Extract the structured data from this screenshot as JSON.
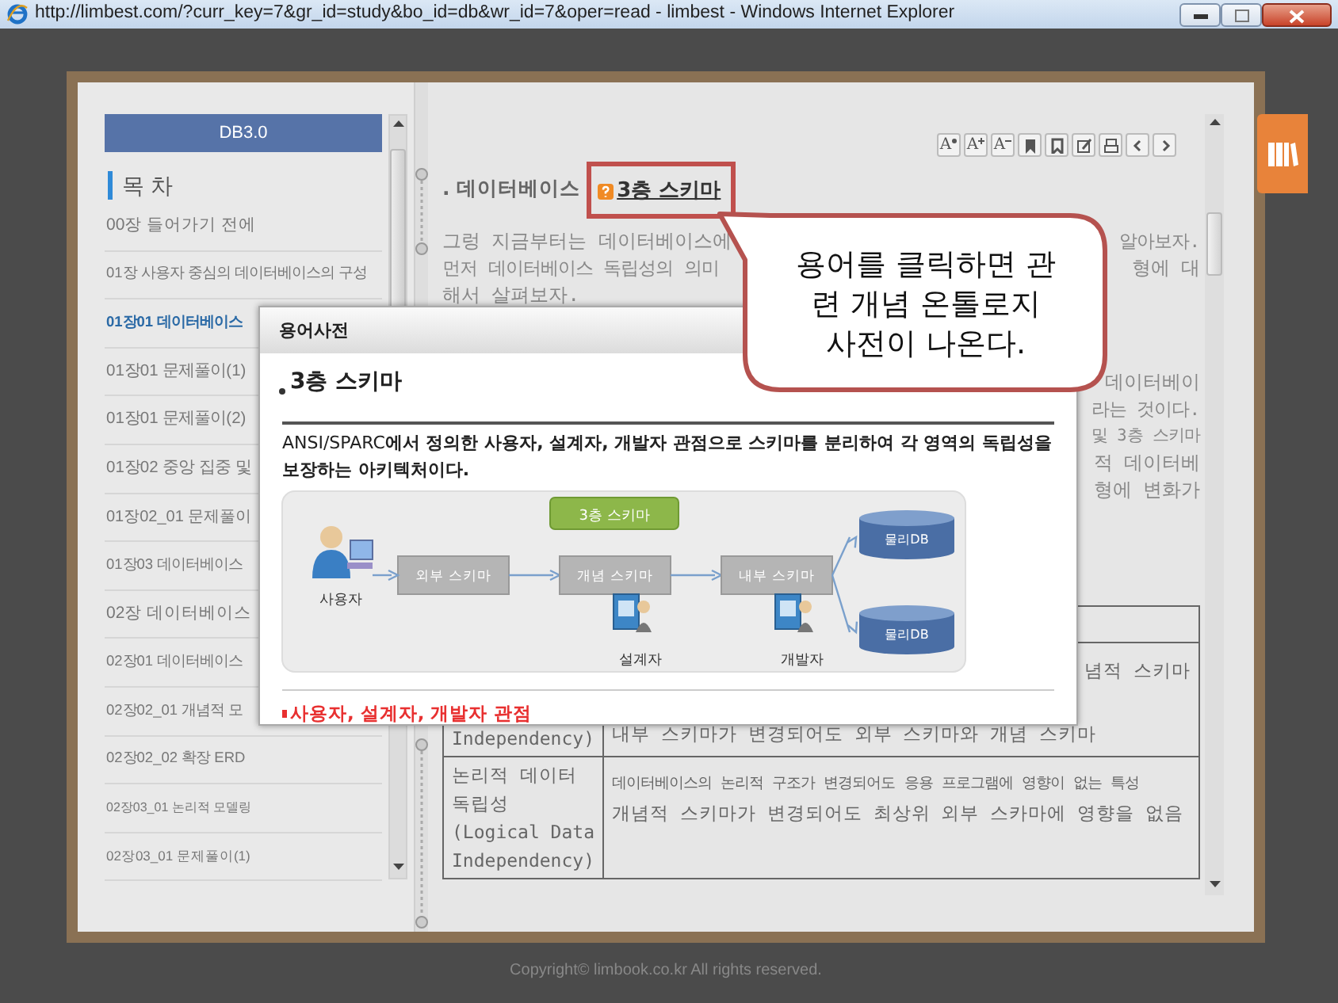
{
  "window": {
    "title": "http://limbest.com/?curr_key=7&gr_id=study&bo_id=db&wr_id=7&oper=read - limbest - Windows Internet Explorer"
  },
  "sidebar": {
    "header": "DB3.0",
    "toc_title": "목 차",
    "items": [
      {
        "label": "00장 들어가기 전에",
        "selected": false
      },
      {
        "label": "01장 사용자 중심의 데이터베이스의 구성",
        "selected": false
      },
      {
        "label": "01장01 데이터베이스",
        "selected": true
      },
      {
        "label": "01장01 문제풀이(1)",
        "selected": false
      },
      {
        "label": "01장01 문제풀이(2)",
        "selected": false
      },
      {
        "label": "01장02 중앙 집중 및",
        "selected": false
      },
      {
        "label": "01장02_01 문제풀이",
        "selected": false
      },
      {
        "label": "01장03 데이터베이스",
        "selected": false
      },
      {
        "label": "02장 데이터베이스",
        "selected": false
      },
      {
        "label": "02장01 데이터베이스",
        "selected": false
      },
      {
        "label": "02장02_01 개념적 모",
        "selected": false
      },
      {
        "label": "02장02_02 확장 ERD",
        "selected": false
      },
      {
        "label": "02장03_01 논리적 모델링",
        "selected": false
      },
      {
        "label": "02장03_01 문제풀이(1)",
        "selected": false
      }
    ]
  },
  "toolbar": [
    {
      "kind": "font-reset",
      "glyph": "A"
    },
    {
      "kind": "font-up",
      "glyph": "A"
    },
    {
      "kind": "font-down",
      "glyph": "A"
    },
    {
      "kind": "bookmark"
    },
    {
      "kind": "bookmark-list"
    },
    {
      "kind": "memo"
    },
    {
      "kind": "print"
    },
    {
      "kind": "prev"
    },
    {
      "kind": "next"
    }
  ],
  "article": {
    "heading": ". 데이터베이스",
    "term_link": "3층 스키마",
    "lines": [
      {
        "left": "그렁 지금부터는 데이터베이스에",
        "right": "알아보자."
      },
      {
        "left": "먼저 데이터베이스 독립성의 의미",
        "right": "형에 대"
      },
      {
        "left": "해서 살펴보자."
      }
    ],
    "more_lines": [
      "데이터베이",
      "라는 것이다.",
      "및 3층 스키마",
      "적 데이터베",
      "형에 변화가"
    ]
  },
  "table": {
    "rows": [
      {
        "kind": "covered"
      },
      {
        "kind": "text",
        "left": [
          "Independency)"
        ],
        "right_top": "념적 스키마",
        "right": [
          "내부 스키마가 변경되어도 외부 스키마와 개념 스키마"
        ]
      },
      {
        "kind": "text",
        "left": [
          "논리적 데이터 독립성",
          "(Logical Data Independency)"
        ],
        "right": [
          "데이터베이스의 논리적 구조가 변경되어도 응용  프로그램에 영향이 없는 특성",
          "개념적 스키마가 변경되어도 최상위 외부 스카마에 영향을 없음"
        ]
      }
    ]
  },
  "popup": {
    "title": "용어사전",
    "term": "3층 스키마",
    "definition": "ANSI/SPARC**에서 정의한 사용자, 설계자, 개발자 관점으로 스키마를 분리하여 각 영역의 독립성을 보장하는 아키텍처이다.**",
    "diagram": {
      "title": "3층 스키마",
      "schemas": [
        "외부 스키마",
        "개념 스키마",
        "내부 스키마"
      ],
      "actors": [
        {
          "label": "사용자",
          "kind": "user"
        },
        {
          "label": "설계자",
          "kind": "designer"
        },
        {
          "label": "개발자",
          "kind": "developer"
        }
      ],
      "databases": [
        "물리DB",
        "물리DB"
      ]
    },
    "keywords": "사용자, 설계자, 개발자 관점"
  },
  "callout": {
    "lines": [
      "용어를 클릭하면 관",
      "련 개념 온톨로지",
      "사전이 나온다."
    ]
  },
  "footer": {
    "copyright": "Copyright© limbook.co.kr All rights reserved."
  }
}
